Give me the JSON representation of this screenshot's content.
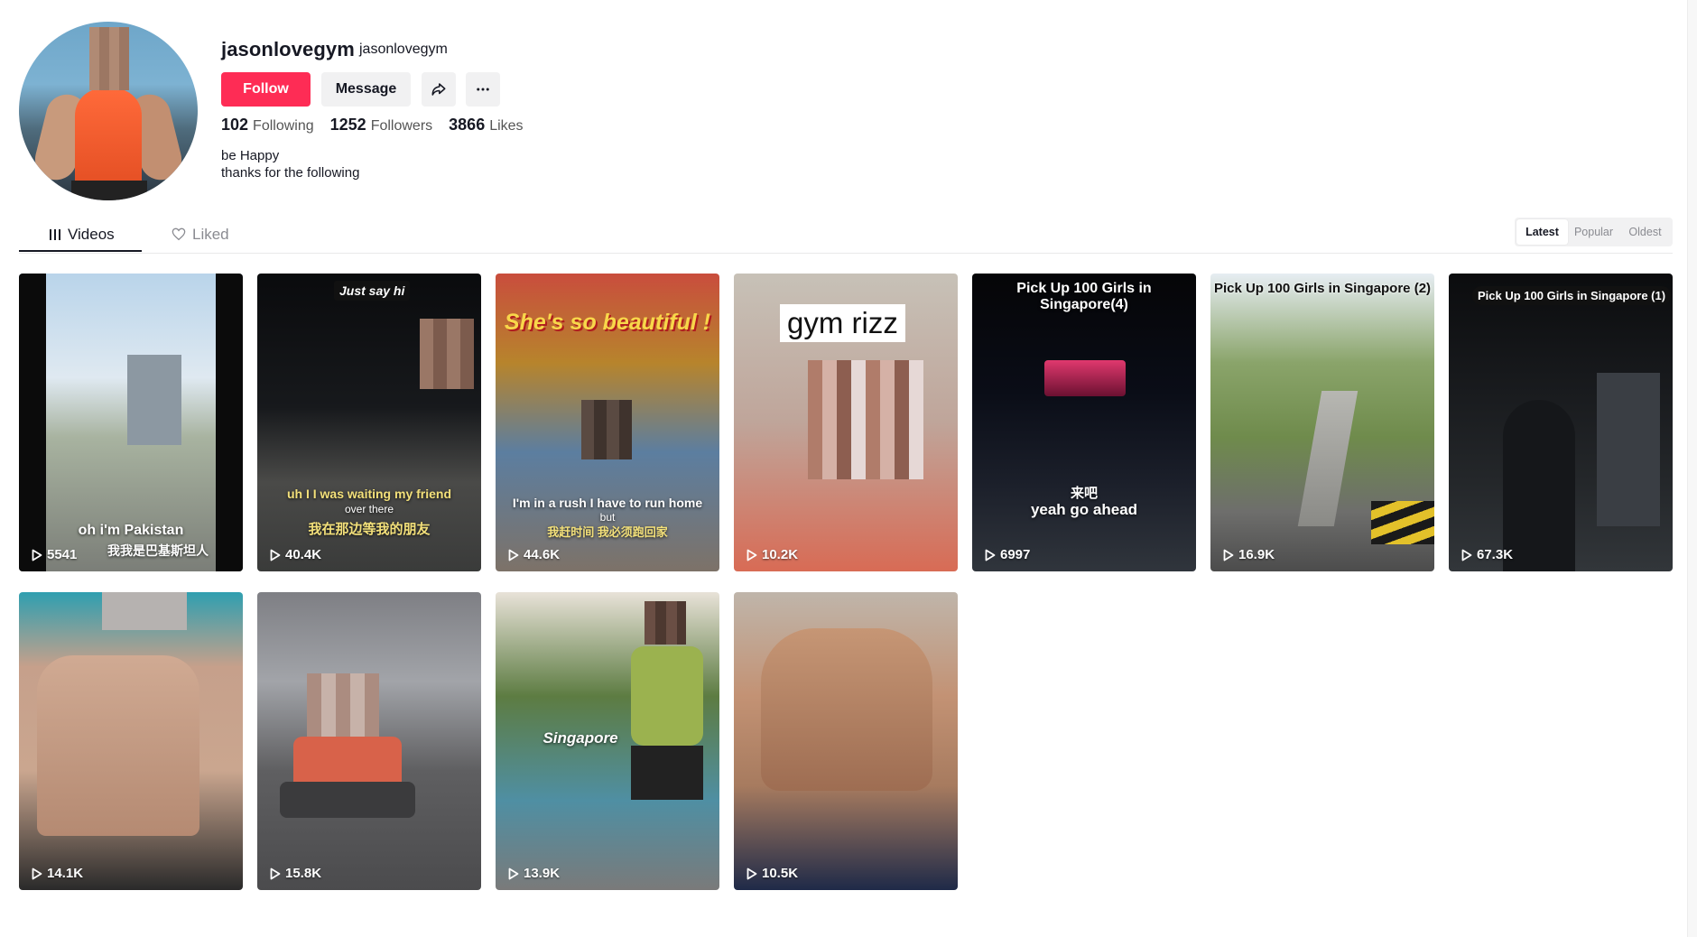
{
  "profile": {
    "username": "jasonlovegym",
    "nickname": "jasonlovegym",
    "follow_label": "Follow",
    "message_label": "Message",
    "stats": {
      "following_count": "102",
      "following_label": "Following",
      "followers_count": "1252",
      "followers_label": "Followers",
      "likes_count": "3866",
      "likes_label": "Likes"
    },
    "bio_line1": "be Happy",
    "bio_line2": "thanks for the following"
  },
  "tabs": {
    "videos_label": "Videos",
    "liked_label": "Liked"
  },
  "sort": {
    "options": [
      "Latest",
      "Popular",
      "Oldest"
    ],
    "selected": "Latest"
  },
  "videos": [
    {
      "views": "5541",
      "caption_en": "oh i'm Pakistan",
      "caption_zh": "我我是巴基斯坦人"
    },
    {
      "views": "40.4K",
      "title_tag": "Just say hi",
      "caption_en_1": "uh I I was waiting my friend",
      "caption_en_2": "over there",
      "caption_zh": "我在那边等我的朋友"
    },
    {
      "views": "44.6K",
      "title_tag": "She's so beautiful !",
      "caption_en_1": "I'm in a rush I have to run home",
      "caption_en_2": "but",
      "caption_zh": "我赶时间 我必须跑回家"
    },
    {
      "views": "10.2K",
      "title_tag": "gym rizz"
    },
    {
      "views": "6997",
      "title_tag": "Pick Up 100 Girls in Singapore(4)",
      "caption_zh": "来吧",
      "caption_en": "yeah go ahead"
    },
    {
      "views": "16.9K",
      "title_tag": "Pick Up 100 Girls in Singapore (2)"
    },
    {
      "views": "67.3K",
      "title_tag": "Pick Up 100 Girls in Singapore (1)"
    },
    {
      "views": "14.1K"
    },
    {
      "views": "15.8K"
    },
    {
      "views": "13.9K",
      "caption_en": "Singapore"
    },
    {
      "views": "10.5K"
    }
  ],
  "colors": {
    "follow_button": "#fe2c55",
    "secondary_button": "#f1f1f2",
    "text_primary": "#161823",
    "text_muted": "#8a8b91"
  },
  "icons": {
    "share": "share-arrow-icon",
    "more": "more-dots-icon",
    "videos_tab": "grid-icon",
    "liked_tab": "heart-outline-icon",
    "play": "play-outline-icon"
  }
}
